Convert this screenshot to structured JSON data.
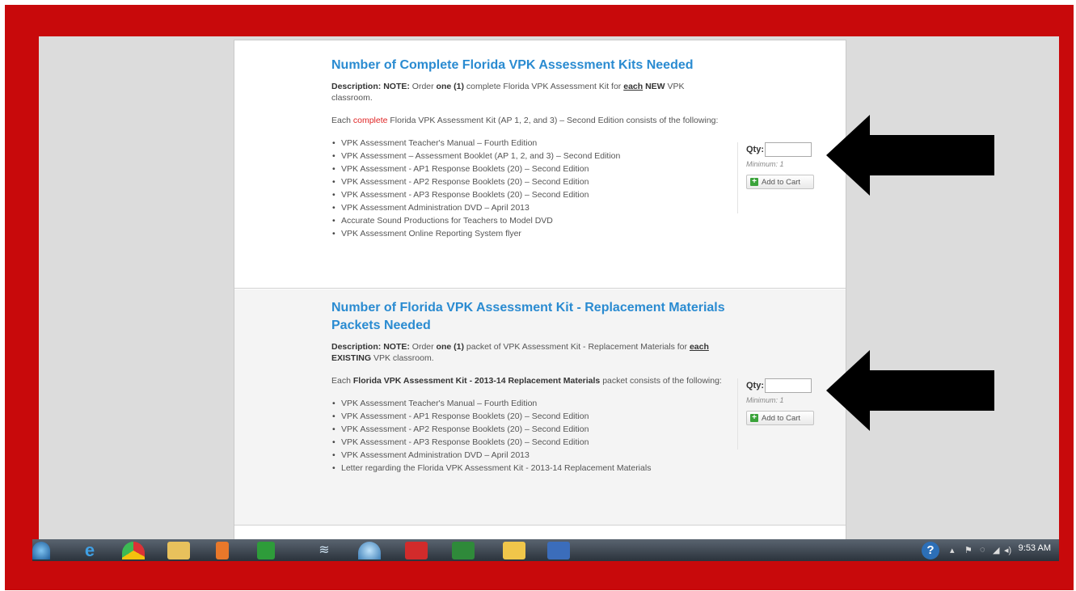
{
  "products": [
    {
      "title": "Number of Complete Florida VPK Assessment Kits Needed",
      "desc_label": "Description:",
      "desc_note": "NOTE:",
      "desc_pre": "Order",
      "desc_one": "one (1)",
      "desc_mid": "complete Florida VPK Assessment Kit for",
      "desc_each": "each",
      "desc_new": "NEW",
      "desc_end": "VPK classroom.",
      "intro_pre": "Each",
      "intro_highlight": "complete",
      "intro_post": "Florida VPK Assessment Kit (AP 1, 2, and 3) – Second Edition consists of the following:",
      "items": [
        "VPK Assessment Teacher's Manual – Fourth Edition",
        "VPK Assessment – Assessment Booklet (AP 1, 2, and 3) – Second Edition",
        "VPK Assessment - AP1 Response Booklets (20) – Second Edition",
        "VPK Assessment - AP2 Response Booklets (20) – Second Edition",
        "VPK Assessment - AP3 Response Booklets (20) – Second Edition",
        "VPK Assessment Administration DVD – April 2013",
        "Accurate Sound Productions for Teachers to Model DVD",
        "VPK Assessment Online Reporting System flyer"
      ],
      "qty_label": "Qty:",
      "qty_value": "",
      "minimum": "Minimum: 1",
      "cart_label": "Add to Cart"
    },
    {
      "title": "Number of Florida VPK Assessment Kit - Replacement Materials Packets Needed",
      "desc_label": "Description:",
      "desc_note": "NOTE:",
      "desc_pre": "Order",
      "desc_one": "one (1)",
      "desc_mid": "packet of VPK Assessment Kit - Replacement Materials for",
      "desc_each": "each",
      "desc_new": "EXISTING",
      "desc_end": "VPK classroom.",
      "intro_pre": "Each",
      "intro_bold": "Florida VPK Assessment Kit - 2013-14 Replacement Materials",
      "intro_post": "packet consists of the following:",
      "items": [
        "VPK Assessment Teacher's Manual – Fourth Edition",
        "VPK Assessment - AP1 Response Booklets (20) – Second Edition",
        "VPK Assessment - AP2 Response Booklets (20) – Second Edition",
        "VPK Assessment - AP3 Response Booklets (20) – Second Edition",
        "VPK Assessment Administration DVD – April 2013",
        "Letter regarding the Florida VPK Assessment Kit - 2013-14 Replacement Materials"
      ],
      "qty_label": "Qty:",
      "qty_value": "",
      "minimum": "Minimum: 1",
      "cart_label": "Add to Cart"
    }
  ],
  "taskbar": {
    "clock": "9:53 AM",
    "apps": [
      "start-orb",
      "internet-explorer",
      "chrome",
      "file-explorer",
      "media-player",
      "green-app",
      "network-app",
      "browser-globe",
      "adobe-reader",
      "excel",
      "outlook",
      "word"
    ]
  },
  "colors": {
    "frame": "#c8090b",
    "title": "#2a8bd1",
    "highlight": "#e02424",
    "arrow": "#000000"
  }
}
